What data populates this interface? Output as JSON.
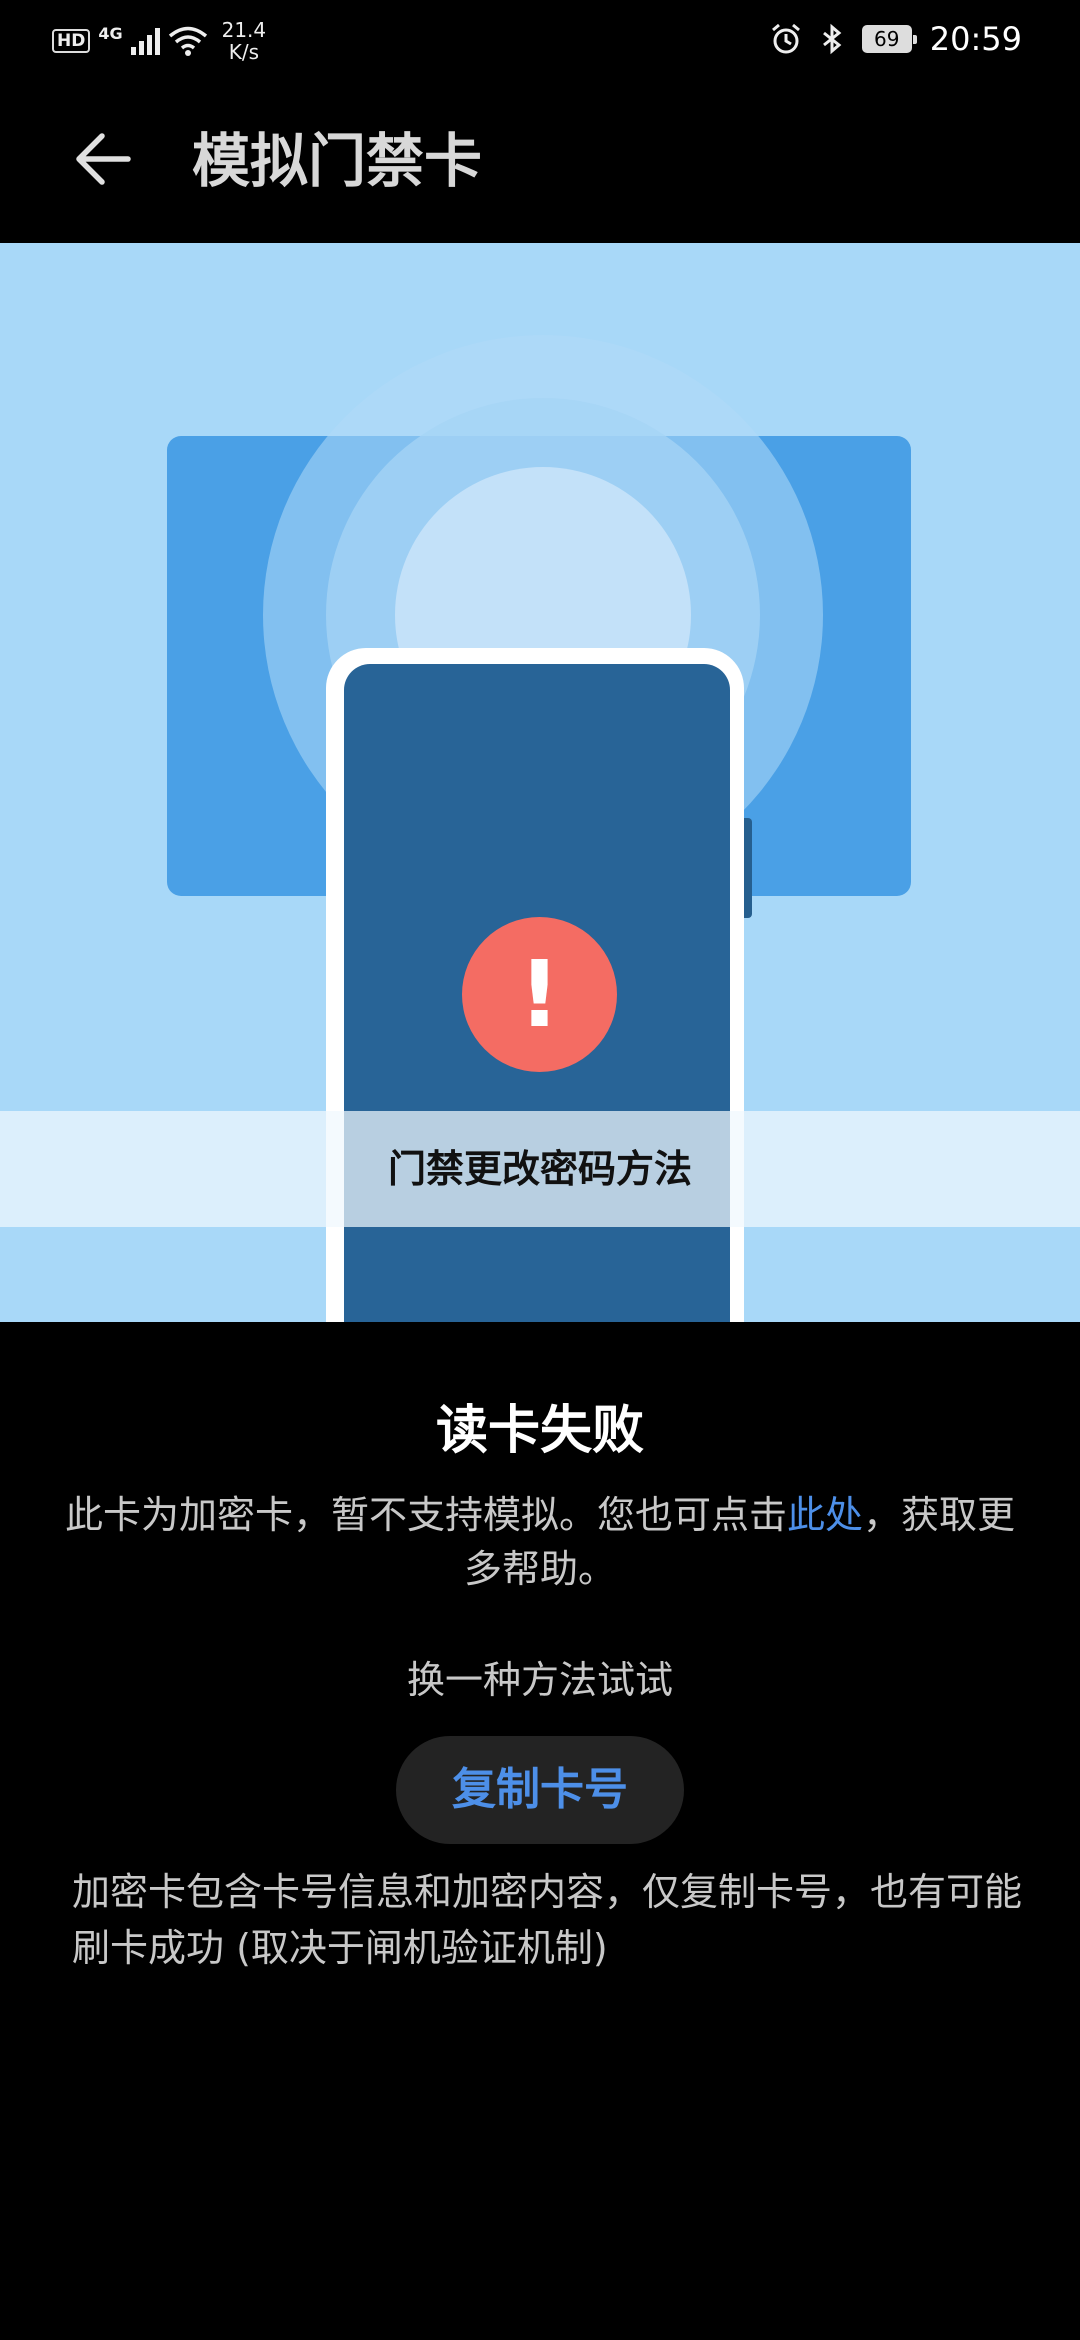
{
  "status_bar": {
    "hd": "HD",
    "network": "4G",
    "speed_value": "21.4",
    "speed_unit": "K/s",
    "battery": "69",
    "time": "20:59",
    "icons": [
      "signal-icon",
      "wifi-icon",
      "alarm-icon",
      "bluetooth-icon",
      "battery-icon"
    ]
  },
  "header": {
    "title": "模拟门禁卡",
    "back_icon": "arrow-left-icon"
  },
  "illustration": {
    "alert_symbol": "!",
    "watermark": "门禁更改密码方法"
  },
  "result": {
    "title": "读卡失败",
    "desc_before": "此卡为加密卡，暂不支持模拟。您也可点击",
    "desc_link": "此处",
    "desc_after": "，获取更多帮助。",
    "alt_hint": "换一种方法试试",
    "copy_button": "复制卡号",
    "note": "加密卡包含卡号信息和加密内容，仅复制卡号，也有可能刷卡成功 (取决于闸机验证机制)"
  },
  "colors": {
    "background": "#000000",
    "link": "#4d8fe8",
    "alert": "#f46c63",
    "illustration_bg": "#a8d8f8",
    "phone_screen": "#286497"
  }
}
